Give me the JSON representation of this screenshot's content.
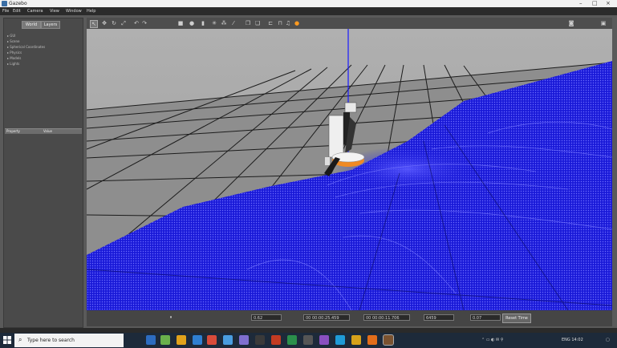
{
  "window": {
    "title": "Gazebo",
    "controls": [
      "–",
      "□",
      "×"
    ]
  },
  "menu": [
    "File",
    "Edit",
    "Camera",
    "View",
    "Window",
    "Help"
  ],
  "left_panel": {
    "tabs": [
      "World",
      "Layers"
    ],
    "tree_items": [
      "▸ GUI",
      "▸ Scene",
      "▸ Spherical Coordinates",
      "▸ Physics",
      "▸ Models",
      "▸ Lights"
    ],
    "property_header": [
      "Property",
      "Value"
    ]
  },
  "toolbar": {
    "icons": [
      "pointer-icon",
      "translate-icon",
      "rotate-icon",
      "scale-icon",
      "undo-icon",
      "redo-icon",
      "box-icon",
      "sphere-icon",
      "cylinder-icon",
      "pointlight-icon",
      "spotlight-icon",
      "dirlight-icon",
      "copy-icon",
      "paste-icon",
      "align-icon",
      "snap-icon",
      "headphones-icon",
      "orange-icon"
    ],
    "right_icons": [
      "screenshot-icon",
      "record-icon"
    ]
  },
  "status": {
    "pause": "⏸",
    "rtf": "0.62",
    "sim_time": "00 00:00:25.459",
    "real_time": "00 00:00:11.706",
    "iterations": "6459",
    "fps": "0.07",
    "reset": "Reset Time"
  },
  "taskbar": {
    "search_placeholder": "Type here to search",
    "tray_text": "ENG 14:02"
  },
  "colors": {
    "ground": "#1414e0",
    "sky": "#a8a8a8",
    "accent": "#ff8c1a"
  }
}
